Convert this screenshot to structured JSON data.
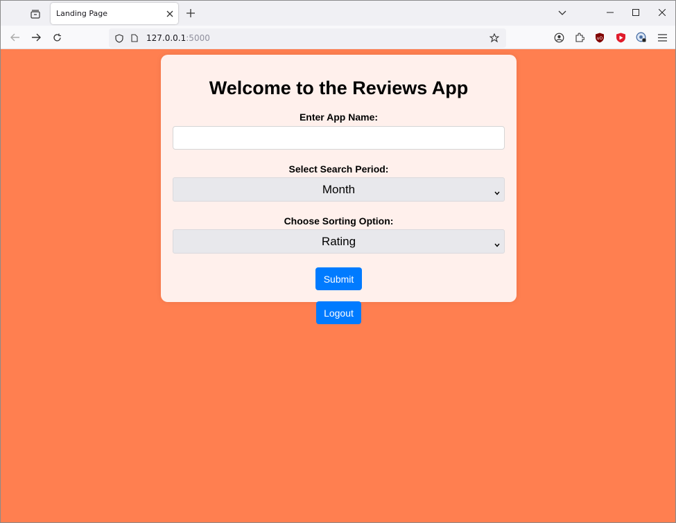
{
  "browser": {
    "tab_title": "Landing Page",
    "url_host": "127.0.0.1",
    "url_port": ":5000"
  },
  "page": {
    "heading": "Welcome to the Reviews App",
    "app_name_label": "Enter App Name:",
    "app_name_value": "",
    "period_label": "Select Search Period:",
    "period_selected": "Month",
    "sort_label": "Choose Sorting Option:",
    "sort_selected": "Rating",
    "submit_label": "Submit",
    "logout_label": "Logout"
  },
  "colors": {
    "page_background": "#ff7f50",
    "card_background": "#fff0ec",
    "button": "#007bff"
  }
}
